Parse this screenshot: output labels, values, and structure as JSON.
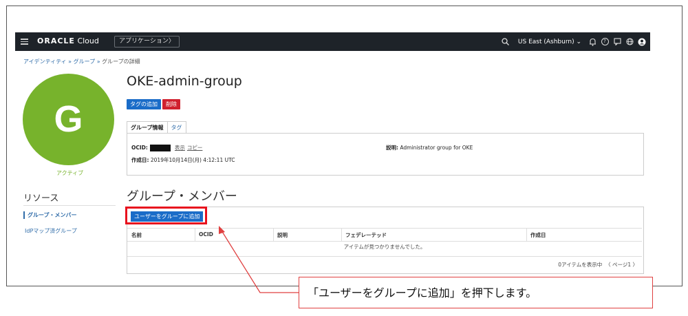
{
  "topbar": {
    "brand_bold": "ORACLE",
    "brand_light": "Cloud",
    "apps_label": "アプリケーション〉",
    "region": "US East (Ashburn)",
    "icons": [
      "search-icon",
      "bell-icon",
      "help-icon",
      "chat-icon",
      "globe-icon",
      "user-icon"
    ]
  },
  "breadcrumb": {
    "item1": "アイデンティティ",
    "sep": " » ",
    "item2": "グループ",
    "current": "グループの詳細"
  },
  "avatar": {
    "letter": "G",
    "status": "アクティブ"
  },
  "resources": {
    "title": "リソース",
    "items": [
      "グループ・メンバー",
      "IdPマップ済グループ"
    ]
  },
  "group": {
    "name": "OKE-admin-group",
    "add_tag_label": "タグの追加",
    "delete_label": "削除",
    "tabs": [
      "グループ情報",
      "タグ"
    ],
    "ocid_label": "OCID:",
    "show_label": "表示",
    "copy_label": "コピー",
    "created_label": "作成日:",
    "created_value": "2019年10月14日(月) 4:12:11 UTC",
    "desc_label": "説明:",
    "desc_value": "Administrator group for OKE"
  },
  "members": {
    "title": "グループ・メンバー",
    "add_button": "ユーザーをグループに追加",
    "columns": [
      "名前",
      "OCID",
      "説明",
      "フェデレーテッド",
      "作成日"
    ],
    "empty_text": "アイテムが見つかりませんでした。",
    "item_count": "0アイテムを表示中",
    "page_label": "ページ1"
  },
  "callout": {
    "text": "「ユーザーをグループに追加」を押下します。"
  },
  "colors": {
    "accent": "#1a6cc8",
    "danger": "#d0202e",
    "avatar": "#77b32c",
    "highlight": "#e8101d",
    "topbar": "#1e2329"
  }
}
